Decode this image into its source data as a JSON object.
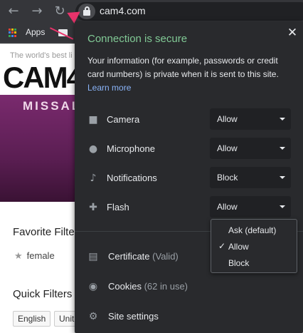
{
  "browser": {
    "back_icon": "back-arrow-icon",
    "forward_icon": "forward-arrow-icon",
    "reload_icon": "reload-icon",
    "url": "cam4.com",
    "bookmarks": {
      "apps_label": "Apps"
    }
  },
  "page": {
    "tagline": "The world's best li",
    "logo": "CAM4",
    "banner_title": "MISSALI",
    "favorite_filters_title": "Favorite Filte",
    "favorite_item": "female",
    "quick_filters_title": "Quick Filters",
    "chips": [
      "English",
      "Unite"
    ]
  },
  "popup": {
    "title": "Connection is secure",
    "description": "Your information (for example, passwords or credit card numbers) is private when it is sent to this site.",
    "learn_more": "Learn more",
    "permissions": [
      {
        "icon": "camera-icon",
        "label": "Camera",
        "value": "Allow"
      },
      {
        "icon": "microphone-icon",
        "label": "Microphone",
        "value": "Allow"
      },
      {
        "icon": "notifications-blocked-icon",
        "label": "Notifications",
        "value": "Block"
      },
      {
        "icon": "puzzle-piece-icon",
        "label": "Flash",
        "value": "Allow"
      }
    ],
    "certificate": {
      "label": "Certificate",
      "sub": "(Valid)"
    },
    "cookies": {
      "label": "Cookies",
      "sub": "(62 in use)"
    },
    "site_settings": "Site settings",
    "dropdown_options": [
      "Ask (default)",
      "Allow",
      "Block"
    ],
    "dropdown_selected": "Allow"
  },
  "colors": {
    "secure_green": "#81c995",
    "link_blue": "#8ab4f8",
    "arrow_pink": "#e8336b",
    "popup_bg": "#292a2d"
  }
}
